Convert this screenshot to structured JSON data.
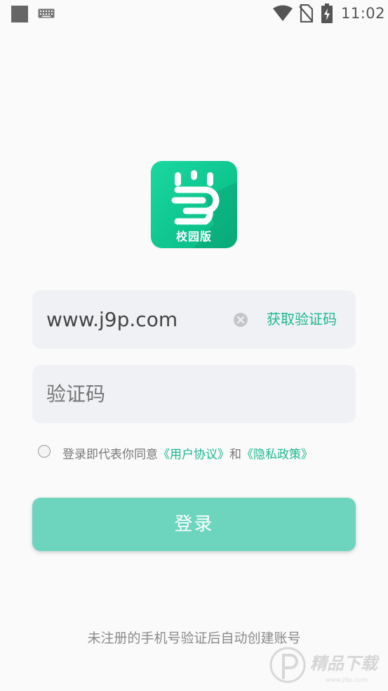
{
  "status_bar": {
    "time": "11:02",
    "icons": [
      "notification-square-icon",
      "keyboard-icon",
      "wifi-icon",
      "no-sim-icon",
      "battery-charging-icon"
    ]
  },
  "logo": {
    "label": "校园版",
    "colors": {
      "primary": "#0fc68f"
    }
  },
  "login_form": {
    "phone_value": "www.j9p.com",
    "get_code_label": "获取验证码",
    "code_placeholder": "验证码",
    "agreement": {
      "prefix": "登录即代表你同意",
      "user_agreement": "《用户协议》",
      "conjunction": "和",
      "privacy_policy": "《隐私政策》"
    },
    "submit_label": "登录"
  },
  "footer_note": "未注册的手机号验证后自动创建账号",
  "watermark": {
    "text": "精品下载",
    "subtext": "www.j9p.com"
  },
  "colors": {
    "accent": "#1bb98d",
    "button": "#6dd5be",
    "input_bg": "#f0f1f4",
    "background": "#fafafa"
  }
}
